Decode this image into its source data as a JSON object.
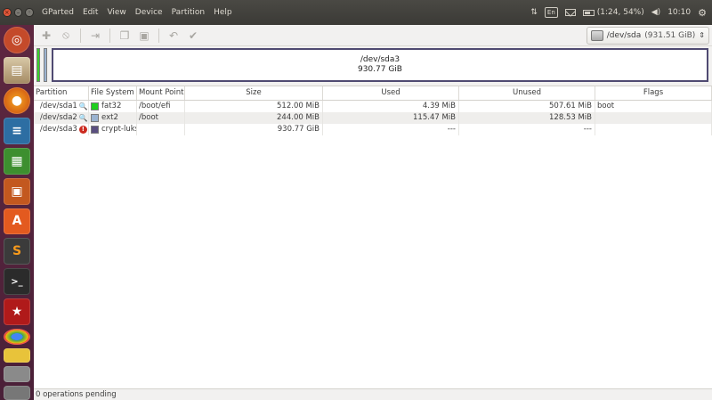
{
  "app": {
    "title": "GParted",
    "menu": [
      "GParted",
      "Edit",
      "View",
      "Device",
      "Partition",
      "Help"
    ]
  },
  "indicators": {
    "keyboard": "En",
    "battery": "(1:24, 54%)",
    "clock": "10:10"
  },
  "toolbar": {
    "device": "/dev/sda",
    "device_size": "(931.51 GiB)"
  },
  "map": {
    "name": "/dev/sda3",
    "size": "930.77 GiB",
    "fragment_colors": [
      "#3ad12b",
      "#9bb3d0"
    ],
    "border_color": "#4f4a72"
  },
  "table": {
    "columns": [
      "Partition",
      "File System",
      "Mount Point",
      "Size",
      "Used",
      "Unused",
      "Flags"
    ],
    "rows": [
      {
        "partition": "/dev/sda1",
        "status_icon": "key-icon",
        "fs": "fat32",
        "fs_color": "#1fcf1f",
        "mount": "/boot/efi",
        "size": "512.00 MiB",
        "used": "4.39 MiB",
        "unused": "507.61 MiB",
        "flags": "boot"
      },
      {
        "partition": "/dev/sda2",
        "status_icon": "key-icon",
        "fs": "ext2",
        "fs_color": "#9bb3d0",
        "mount": "/boot",
        "size": "244.00 MiB",
        "used": "115.47 MiB",
        "unused": "128.53 MiB",
        "flags": ""
      },
      {
        "partition": "/dev/sda3",
        "status_icon": "warning-icon",
        "fs": "crypt-luks",
        "fs_color": "#5a4f80",
        "mount": "",
        "size": "930.77 GiB",
        "used": "---",
        "unused": "---",
        "flags": ""
      }
    ]
  },
  "status": {
    "text": "0 operations pending"
  }
}
